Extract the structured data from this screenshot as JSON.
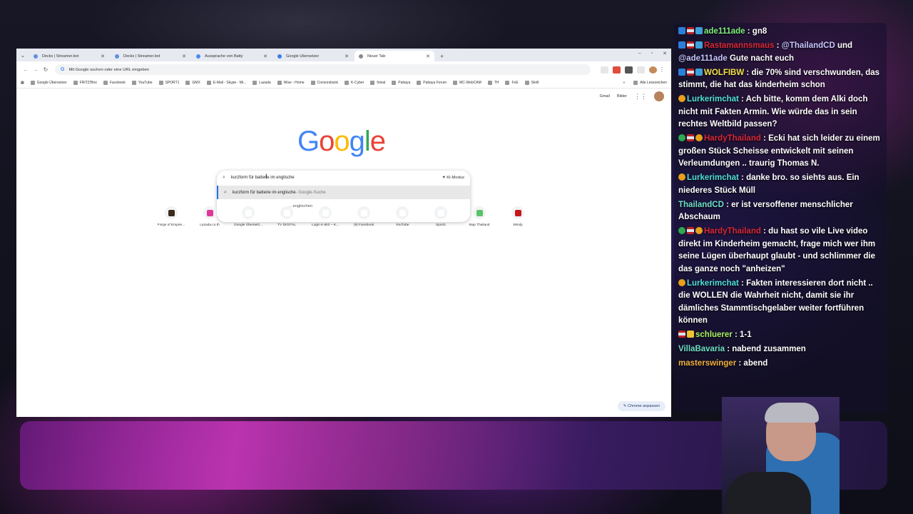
{
  "browser": {
    "tabs": [
      {
        "title": "Decks | Streamer.bot",
        "icon": "streamerbot-icon"
      },
      {
        "title": "Decks | Streamer.bot",
        "icon": "streamerbot-icon"
      },
      {
        "title": "Aussprache von Batty",
        "icon": "google-icon"
      },
      {
        "title": "Google Übersetzer",
        "icon": "translate-icon"
      },
      {
        "title": "Neuer Tab",
        "icon": "chrome-icon",
        "active": true
      }
    ],
    "omnibox_placeholder": "Mit Google suchen oder eine URL eingeben",
    "bookmarks": [
      "Google Übersetzer",
      "FRITZ!Box",
      "Facebook",
      "YouTube",
      "SPORT1",
      "GMX",
      "E-Mail - Skype - Mi...",
      "Lazada",
      "Wise - Home",
      "Consorsbank",
      "K-Cyber",
      "fonial",
      "Pattaya",
      "Pattaya Forum",
      "MC-WebCAM",
      "TH",
      "FoE",
      "Skrill"
    ],
    "bookmarks_all": "Alle Lesezeichen",
    "toplinks": {
      "gmail": "Gmail",
      "images": "Bilder"
    },
    "logo": [
      "G",
      "o",
      "o",
      "g",
      "l",
      "e"
    ],
    "logo_colors": [
      "#4285F4",
      "#EA4335",
      "#FBBC05",
      "#4285F4",
      "#34A853",
      "#EA4335"
    ],
    "search_value": "kurzform für batterie im englische",
    "ki_mode": "KI-Modus",
    "suggestion": {
      "text": "kurzform für batterie im englische",
      "hint": " - Google-Suche"
    },
    "suggestion2": "... englischen",
    "shortcuts": [
      {
        "label": "Forge of Empire...",
        "color": "#3a2a1a"
      },
      {
        "label": "Lazada.co.th",
        "color": "#e0389a"
      },
      {
        "label": "Google Übersetz...",
        "color": "#ffffff"
      },
      {
        "label": "TV DIGITAL",
        "color": "#ffffff"
      },
      {
        "label": "Login K-BIZ – K...",
        "color": "#ffffff"
      },
      {
        "label": "(8) Facebook",
        "color": "#ffffff"
      },
      {
        "label": "YouTube",
        "color": "#ffffff"
      },
      {
        "label": "Sport1",
        "color": "#ffffff"
      },
      {
        "label": "Map Thailand",
        "color": "#5ac36a"
      },
      {
        "label": "Windy",
        "color": "#c4161c"
      }
    ],
    "customize": "Chrome anpassen"
  },
  "chat": [
    {
      "badges": [
        "prime",
        "flag",
        "sub"
      ],
      "user": "ade111ade",
      "user_class": "u-green",
      "text": "gn8"
    },
    {
      "badges": [
        "prime",
        "flag",
        "sub"
      ],
      "user": "Rastamannsmaus",
      "user_class": "u-red",
      "text": "",
      "mention": "@ThailandCD",
      "after": " und ",
      "mention2": "@ade111ade",
      "after2": " Gute nacht euch"
    },
    {
      "badges": [
        "prime",
        "flag",
        "sub"
      ],
      "user": "WOLFIBW",
      "user_class": "u-yellow",
      "text": "die 70% sind verschwunden, das stimmt, die hat das kinderheim schon"
    },
    {
      "badges": [
        "bits"
      ],
      "user": "Lurkerimchat",
      "user_class": "u-cyan",
      "text": "Ach bitte, komm dem Alki doch nicht mit Fakten Armin. Wie würde das in sein rechtes Weltbild passen?"
    },
    {
      "badges": [
        "mod",
        "flag",
        "bits"
      ],
      "user": "HardyThailand",
      "user_class": "u-red",
      "text": "Ecki hat sich leider zu einem großen Stück Scheisse entwickelt mit seinen Verleumdungen .. traurig Thomas N."
    },
    {
      "badges": [
        "bits"
      ],
      "user": "Lurkerimchat",
      "user_class": "u-cyan",
      "text": "danke bro. so siehts aus. Ein niederes Stück Müll"
    },
    {
      "badges": [],
      "user": "ThailandCD",
      "user_class": "u-mint",
      "text": "er ist versoffener menschlicher Abschaum"
    },
    {
      "badges": [
        "mod",
        "flag",
        "bits"
      ],
      "user": "HardyThailand",
      "user_class": "u-red",
      "text": "du hast so vile Live video direkt im Kinderheim gemacht, frage mich wer ihm seine Lügen überhaupt glaubt - und schlimmer die das ganze noch \"anheizen\""
    },
    {
      "badges": [
        "bits"
      ],
      "user": "Lurkerimchat",
      "user_class": "u-cyan",
      "text": "Fakten interessieren dort nicht .. die WOLLEN die Wahrheit nicht, damit sie ihr dämliches Stammtischgelaber weiter fortführen können"
    },
    {
      "badges": [
        "flag",
        "crown"
      ],
      "user": "schluerer",
      "user_class": "u-lime",
      "text": "1-1"
    },
    {
      "badges": [],
      "user": "VillaBavaria",
      "user_class": "u-mint",
      "text": "nabend zusammen"
    },
    {
      "badges": [],
      "user": "masterswinger",
      "user_class": "u-orange",
      "text": "abend"
    }
  ]
}
